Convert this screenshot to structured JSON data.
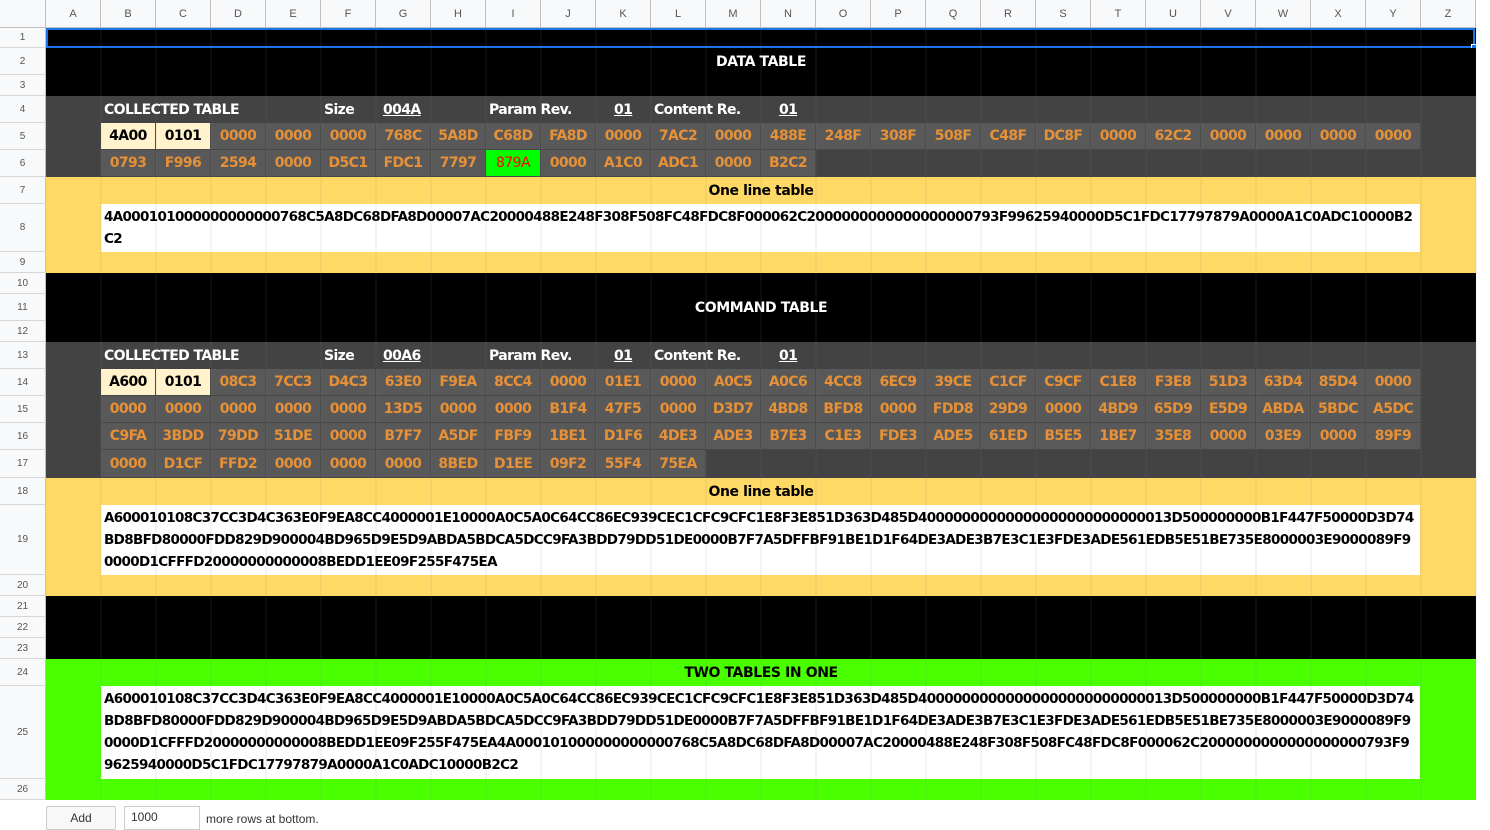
{
  "columns": [
    "A",
    "B",
    "C",
    "D",
    "E",
    "F",
    "G",
    "H",
    "I",
    "J",
    "K",
    "L",
    "M",
    "N",
    "O",
    "P",
    "Q",
    "R",
    "S",
    "T",
    "U",
    "V",
    "W",
    "X",
    "Y",
    "Z"
  ],
  "rows": [
    "1",
    "2",
    "3",
    "4",
    "5",
    "6",
    "7",
    "8",
    "9",
    "10",
    "11",
    "12",
    "13",
    "14",
    "15",
    "16",
    "17",
    "18",
    "19",
    "20",
    "21",
    "22",
    "23",
    "24",
    "25",
    "26"
  ],
  "colors": {
    "black": "#000000",
    "dark_gray": "#434343",
    "hex_bg": "#595959",
    "hex_text": "#e69138",
    "yellow": "#ffd966",
    "green": "#4aff00",
    "cream": "#fff2cc",
    "flag_bg": "#00ff00",
    "flag_text": "#ff0000",
    "selection": "#1a73e8"
  },
  "data_section": {
    "title": "DATA TABLE",
    "collected_label": "COLLECTED TABLE",
    "size_label": "Size",
    "size_value": "004A",
    "param_label": "Param Rev.",
    "param_value": "01",
    "content_label": "Content Re.",
    "content_value": "01",
    "row5": [
      "4A00",
      "0101",
      "0000",
      "0000",
      "0000",
      "768C",
      "5A8D",
      "C68D",
      "FA8D",
      "0000",
      "7AC2",
      "0000",
      "488E",
      "248F",
      "308F",
      "508F",
      "C48F",
      "DC8F",
      "0000",
      "62C2",
      "0000",
      "0000",
      "0000",
      "0000"
    ],
    "row6": [
      "0793",
      "F996",
      "2594",
      "0000",
      "D5C1",
      "FDC1",
      "7797",
      "879A",
      "0000",
      "A1C0",
      "ADC1",
      "0000",
      "B2C2"
    ],
    "one_line_title": "One line table",
    "one_line_value": "4A000101000000000000768C5A8DC68DFA8D00007AC20000488E248F308F508FC48FDC8F000062C2000000000000000000793F99625940000D5C1FDC17797879A0000A1C0ADC10000B2C2"
  },
  "command_section": {
    "title": "COMMAND TABLE",
    "collected_label": "COLLECTED TABLE",
    "size_label": "Size",
    "size_value": "00A6",
    "param_label": "Param Rev.",
    "param_value": "01",
    "content_label": "Content Re.",
    "content_value": "01",
    "row14": [
      "A600",
      "0101",
      "08C3",
      "7CC3",
      "D4C3",
      "63E0",
      "F9EA",
      "8CC4",
      "0000",
      "01E1",
      "0000",
      "A0C5",
      "A0C6",
      "4CC8",
      "6EC9",
      "39CE",
      "C1CF",
      "C9CF",
      "C1E8",
      "F3E8",
      "51D3",
      "63D4",
      "85D4",
      "0000"
    ],
    "row15": [
      "0000",
      "0000",
      "0000",
      "0000",
      "0000",
      "13D5",
      "0000",
      "0000",
      "B1F4",
      "47F5",
      "0000",
      "D3D7",
      "4BD8",
      "BFD8",
      "0000",
      "FDD8",
      "29D9",
      "0000",
      "4BD9",
      "65D9",
      "E5D9",
      "ABDA",
      "5BDC",
      "A5DC"
    ],
    "row16": [
      "C9FA",
      "3BDD",
      "79DD",
      "51DE",
      "0000",
      "B7F7",
      "A5DF",
      "FBF9",
      "1BE1",
      "D1F6",
      "4DE3",
      "ADE3",
      "B7E3",
      "C1E3",
      "FDE3",
      "ADE5",
      "61ED",
      "B5E5",
      "1BE7",
      "35E8",
      "0000",
      "03E9",
      "0000",
      "89F9"
    ],
    "row17": [
      "0000",
      "D1CF",
      "FFD2",
      "0000",
      "0000",
      "0000",
      "8BED",
      "D1EE",
      "09F2",
      "55F4",
      "75EA"
    ],
    "one_line_title": "One line table",
    "one_line_value": "A600010108C37CC3D4C363E0F9EA8CC4000001E10000A0C5A0C64CC86EC939CEC1CFC9CFC1E8F3E851D363D485D40000000000000000000000000013D500000000B1F447F50000D3D74BD8BFD80000FDD829D900004BD965D9E5D9ABDA5BDCA5DCC9FA3BDD79DD51DE0000B7F7A5DFFBF91BE1D1F64DE3ADE3B7E3C1E3FDE3ADE561EDB5E51BE735E8000003E9000089F90000D1CFFFD20000000000008BEDD1EE09F255F475EA"
  },
  "combined_section": {
    "title": "TWO TABLES IN ONE",
    "value": "A600010108C37CC3D4C363E0F9EA8CC4000001E10000A0C5A0C64CC86EC939CEC1CFC9CFC1E8F3E851D363D485D40000000000000000000000000013D500000000B1F447F50000D3D74BD8BFD80000FDD829D900004BD965D9E5D9ABDA5BDCA5DCC9FA3BDD79DD51DE0000B7F7A5DFFBF91BE1D1F64DE3ADE3B7E3C1E3FDE3ADE561EDB5E51BE735E8000003E9000089F90000D1CFFFD20000000000008BEDD1EE09F255F475EA4A000101000000000000768C5A8DC68DFA8D00007AC20000488E248F308F508FC48FDC8F000062C2000000000000000000793F99625940000D5C1FDC17797879A0000A1C0ADC10000B2C2"
  },
  "footer": {
    "add_label": "Add",
    "rows_value": "1000",
    "more_label": "more rows at bottom."
  }
}
